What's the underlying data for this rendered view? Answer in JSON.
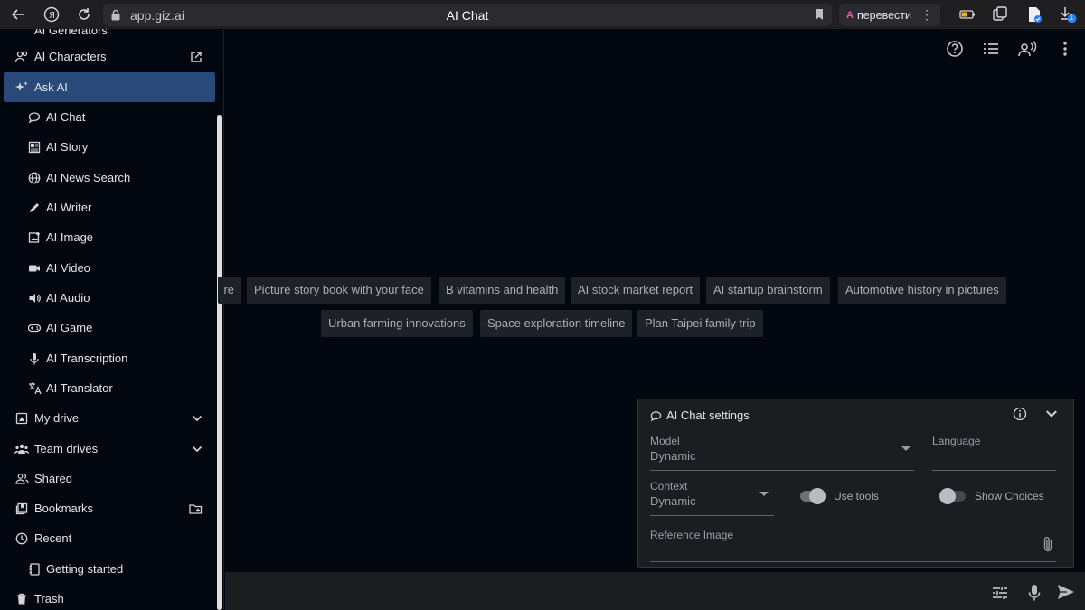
{
  "browser": {
    "url": "app.giz.ai",
    "title": "AI Chat",
    "translate_label": "перевести",
    "translate_icon_text": "A",
    "download_badge": "1"
  },
  "sidebar": {
    "partial_top_label": "AI Generators",
    "items": [
      {
        "label": "AI Characters",
        "icon": "people-icon",
        "level": 0
      },
      {
        "label": "Ask AI",
        "icon": "sparkle-icon",
        "level": 0,
        "active": true
      },
      {
        "label": "AI Chat",
        "icon": "chat-bubble-icon",
        "level": 1
      },
      {
        "label": "AI Story",
        "icon": "story-icon",
        "level": 1
      },
      {
        "label": "AI News Search",
        "icon": "globe-icon",
        "level": 1
      },
      {
        "label": "AI Writer",
        "icon": "pen-icon",
        "level": 1
      },
      {
        "label": "AI Image",
        "icon": "image-icon",
        "level": 1
      },
      {
        "label": "AI Video",
        "icon": "video-icon",
        "level": 1
      },
      {
        "label": "AI Audio",
        "icon": "speaker-icon",
        "level": 1
      },
      {
        "label": "AI Game",
        "icon": "gamepad-icon",
        "level": 1
      },
      {
        "label": "AI Transcription",
        "icon": "microphone-icon",
        "level": 1
      },
      {
        "label": "AI Translator",
        "icon": "translate-icon",
        "level": 1
      },
      {
        "label": "My drive",
        "icon": "drive-icon",
        "level": 0
      },
      {
        "label": "Team drives",
        "icon": "team-icon",
        "level": 0
      },
      {
        "label": "Shared",
        "icon": "shared-icon",
        "level": 0
      },
      {
        "label": "Bookmarks",
        "icon": "bookmarks-icon",
        "level": 0
      },
      {
        "label": "Recent",
        "icon": "clock-icon",
        "level": 0
      },
      {
        "label": "Getting started",
        "icon": "notebook-icon",
        "level": 1
      },
      {
        "label": "Trash",
        "icon": "trash-icon",
        "level": 0
      }
    ]
  },
  "suggestions": {
    "row1": [
      "re",
      "Picture story book with your face",
      "B vitamins and health",
      "AI stock market report",
      "AI startup brainstorm",
      "Automotive history in pictures"
    ],
    "row2": [
      "Urban farming innovations",
      "Space exploration timeline",
      "Plan Taipei family trip"
    ]
  },
  "settings": {
    "title": "AI Chat settings",
    "model_label": "Model",
    "model_value": "Dynamic",
    "language_label": "Language",
    "language_value": "",
    "context_label": "Context",
    "context_value": "Dynamic",
    "use_tools_label": "Use tools",
    "use_tools_on": true,
    "show_choices_label": "Show Choices",
    "show_choices_on": false,
    "reference_image_label": "Reference Image"
  },
  "colors": {
    "active_item": "#294a78",
    "background": "#03070f",
    "panel": "#1b1d21",
    "chip": "#1e2228"
  }
}
